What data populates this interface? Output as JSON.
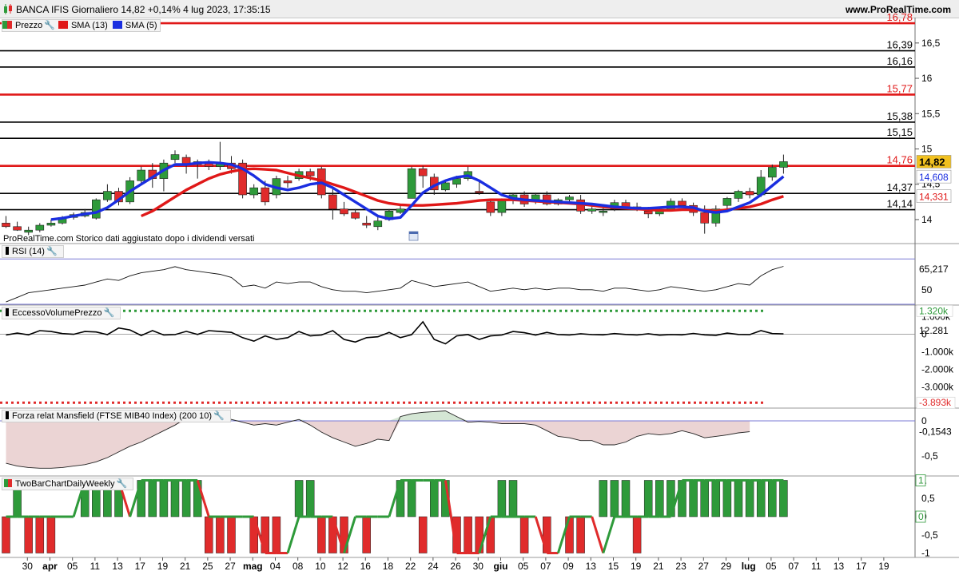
{
  "header": {
    "title": "BANCA IFIS Giornaliero 14,82 +0,14% 4 lug 2023, 17:35:15",
    "site": "www.ProRealTime.com",
    "footnote": "ProRealTime.com  Storico dati aggiustato dopo i dividendi versati"
  },
  "colors": {
    "up": "#2e9a3a",
    "down": "#e02b2b",
    "sma13": "#e01818",
    "sma5": "#1a2ee0",
    "panel_line": "#7a7ad6"
  },
  "price_panel": {
    "legend": [
      {
        "label": "Prezzo",
        "icon": "candle-icon",
        "color": "#2e9a3a"
      },
      {
        "label": "SMA (13)",
        "icon": "square-icon",
        "color": "#e01818"
      },
      {
        "label": "SMA (5)",
        "icon": "square-icon",
        "color": "#1a2ee0"
      }
    ],
    "ylim": [
      13.66,
      16.86
    ],
    "ticks": [
      {
        "v": 16.5,
        "label": "16,5"
      },
      {
        "v": 16,
        "label": "16"
      },
      {
        "v": 15.5,
        "label": "15,5"
      },
      {
        "v": 15,
        "label": "15"
      },
      {
        "v": 14.5,
        "label": "14,5"
      },
      {
        "v": 14,
        "label": "14"
      }
    ],
    "levels": [
      {
        "v": 16.78,
        "label": "16,78",
        "color": "#e01818"
      },
      {
        "v": 16.39,
        "label": "16,39",
        "color": "#000000"
      },
      {
        "v": 16.16,
        "label": "16,16",
        "color": "#000000"
      },
      {
        "v": 15.77,
        "label": "15,77",
        "color": "#e01818"
      },
      {
        "v": 15.38,
        "label": "15,38",
        "color": "#000000"
      },
      {
        "v": 15.15,
        "label": "15,15",
        "color": "#000000"
      },
      {
        "v": 14.76,
        "label": "14,76",
        "color": "#e01818"
      },
      {
        "v": 14.37,
        "label": "14,37",
        "color": "#000000"
      },
      {
        "v": 14.14,
        "label": "14,14",
        "color": "#000000"
      }
    ],
    "last_labels": [
      {
        "v": 14.82,
        "label": "14,82",
        "bg": "#f0c020",
        "fg": "#000000"
      },
      {
        "v": 14.608,
        "label": "14,608",
        "bg": "#ffffff",
        "fg": "#1a2ee0"
      },
      {
        "v": 14.331,
        "label": "14,331",
        "bg": "#ffffff",
        "fg": "#e01818"
      }
    ]
  },
  "x_axis": {
    "ticks": [
      {
        "i": 0,
        "label": "30",
        "bold": false
      },
      {
        "i": 2,
        "label": "apr",
        "bold": true
      },
      {
        "i": 4,
        "label": "05",
        "bold": false
      },
      {
        "i": 6,
        "label": "11",
        "bold": false
      },
      {
        "i": 8,
        "label": "13",
        "bold": false
      },
      {
        "i": 10,
        "label": "17",
        "bold": false
      },
      {
        "i": 12,
        "label": "19",
        "bold": false
      },
      {
        "i": 14,
        "label": "21",
        "bold": false
      },
      {
        "i": 16,
        "label": "25",
        "bold": false
      },
      {
        "i": 18,
        "label": "27",
        "bold": false
      },
      {
        "i": 20,
        "label": "mag",
        "bold": true
      },
      {
        "i": 22,
        "label": "04",
        "bold": false
      },
      {
        "i": 24,
        "label": "08",
        "bold": false
      },
      {
        "i": 26,
        "label": "10",
        "bold": false
      },
      {
        "i": 28,
        "label": "12",
        "bold": false
      },
      {
        "i": 30,
        "label": "16",
        "bold": false
      },
      {
        "i": 32,
        "label": "18",
        "bold": false
      },
      {
        "i": 34,
        "label": "22",
        "bold": false
      },
      {
        "i": 36,
        "label": "24",
        "bold": false
      },
      {
        "i": 38,
        "label": "26",
        "bold": false
      },
      {
        "i": 40,
        "label": "30",
        "bold": false
      },
      {
        "i": 42,
        "label": "giu",
        "bold": true
      },
      {
        "i": 44,
        "label": "05",
        "bold": false
      },
      {
        "i": 46,
        "label": "07",
        "bold": false
      },
      {
        "i": 48,
        "label": "09",
        "bold": false
      },
      {
        "i": 50,
        "label": "13",
        "bold": false
      },
      {
        "i": 52,
        "label": "15",
        "bold": false
      },
      {
        "i": 54,
        "label": "19",
        "bold": false
      },
      {
        "i": 56,
        "label": "21",
        "bold": false
      },
      {
        "i": 58,
        "label": "23",
        "bold": false
      },
      {
        "i": 60,
        "label": "27",
        "bold": false
      },
      {
        "i": 62,
        "label": "29",
        "bold": false
      },
      {
        "i": 64,
        "label": "lug",
        "bold": true
      },
      {
        "i": 66,
        "label": "05",
        "bold": false
      },
      {
        "i": 68,
        "label": "07",
        "bold": false
      },
      {
        "i": 70,
        "label": "11",
        "bold": false
      },
      {
        "i": 72,
        "label": "13",
        "bold": false
      },
      {
        "i": 74,
        "label": "17",
        "bold": false
      },
      {
        "i": 76,
        "label": "19",
        "bold": false
      }
    ]
  },
  "rsi_panel": {
    "legend": "RSI (14)",
    "ylim": [
      40,
      80
    ],
    "ticks": [
      {
        "v": 50,
        "label": "50"
      }
    ],
    "bands": [
      70,
      30
    ],
    "last_label": "65,217"
  },
  "evp_panel": {
    "legend": "EccessoVolumePrezzo",
    "ylim": [
      -4200,
      1650
    ],
    "ticks": [
      {
        "v": 1000,
        "label": "1.000k"
      },
      {
        "v": 0,
        "label": "0"
      },
      {
        "v": -1000,
        "label": "-1.000k"
      },
      {
        "v": -2000,
        "label": "-2.000k"
      },
      {
        "v": -3000,
        "label": "-3.000k"
      }
    ],
    "upper": {
      "v": 1320,
      "label": "1.320k",
      "color": "#2e9a3a"
    },
    "lower": {
      "v": -3893,
      "label": "-3.893k",
      "color": "#e02b2b"
    },
    "last_label": "12.281"
  },
  "mansfield_panel": {
    "legend": "Forza relat Mansfield (FTSE MIB40 Index) (200 10)",
    "ylim": [
      -0.78,
      0.18
    ],
    "ticks": [
      {
        "v": 0,
        "label": "0"
      },
      {
        "v": -0.5,
        "label": "-0,5"
      }
    ],
    "last_label": "-0,1543"
  },
  "twobar_panel": {
    "legend": "TwoBarChartDailyWeekly",
    "ylim": [
      -1.12,
      1.12
    ],
    "ticks": [
      {
        "v": 1,
        "label": "1"
      },
      {
        "v": 0.5,
        "label": "0,5"
      },
      {
        "v": 0,
        "label": "0"
      },
      {
        "v": -0.5,
        "label": "-0,5"
      },
      {
        "v": -1,
        "label": "-1"
      }
    ]
  },
  "chart_data": {
    "type": "candlestick",
    "title": "BANCA IFIS Giornaliero",
    "ohlc": [
      [
        13.95,
        14.05,
        13.88,
        13.9
      ],
      [
        13.9,
        13.97,
        13.84,
        13.85
      ],
      [
        13.82,
        13.9,
        13.78,
        13.85
      ],
      [
        13.85,
        13.95,
        13.82,
        13.92
      ],
      [
        13.92,
        14.0,
        13.9,
        13.95
      ],
      [
        13.95,
        14.05,
        13.93,
        14.03
      ],
      [
        14.03,
        14.1,
        14.0,
        14.07
      ],
      [
        14.05,
        14.15,
        14.03,
        14.1
      ],
      [
        14.02,
        14.3,
        14.0,
        14.28
      ],
      [
        14.28,
        14.5,
        14.25,
        14.4
      ],
      [
        14.4,
        14.45,
        14.2,
        14.25
      ],
      [
        14.25,
        14.6,
        14.22,
        14.55
      ],
      [
        14.55,
        14.75,
        14.5,
        14.7
      ],
      [
        14.7,
        14.8,
        14.45,
        14.58
      ],
      [
        14.58,
        14.85,
        14.4,
        14.8
      ],
      [
        14.85,
        14.98,
        14.8,
        14.92
      ],
      [
        14.88,
        14.92,
        14.65,
        14.78
      ],
      [
        14.78,
        14.85,
        14.58,
        14.82
      ],
      [
        14.82,
        14.85,
        14.7,
        14.75
      ],
      [
        14.75,
        15.1,
        14.7,
        14.8
      ],
      [
        14.8,
        14.9,
        14.65,
        14.72
      ],
      [
        14.8,
        14.85,
        14.3,
        14.35
      ],
      [
        14.35,
        14.5,
        14.3,
        14.45
      ],
      [
        14.45,
        14.55,
        14.2,
        14.25
      ],
      [
        14.35,
        14.62,
        14.3,
        14.58
      ],
      [
        14.55,
        14.62,
        14.45,
        14.52
      ],
      [
        14.58,
        14.72,
        14.55,
        14.68
      ],
      [
        14.68,
        14.72,
        14.55,
        14.62
      ],
      [
        14.72,
        14.75,
        14.3,
        14.35
      ],
      [
        14.35,
        14.45,
        14.0,
        14.15
      ],
      [
        14.15,
        14.25,
        14.05,
        14.08
      ],
      [
        14.1,
        14.15,
        14.0,
        14.02
      ],
      [
        13.95,
        14.05,
        13.88,
        13.92
      ],
      [
        13.9,
        14.05,
        13.85,
        13.98
      ],
      [
        14.0,
        14.15,
        13.98,
        14.12
      ],
      [
        14.1,
        14.2,
        14.08,
        14.15
      ],
      [
        14.3,
        14.75,
        14.3,
        14.72
      ],
      [
        14.72,
        14.76,
        14.45,
        14.62
      ],
      [
        14.6,
        14.65,
        14.35,
        14.42
      ],
      [
        14.42,
        14.55,
        14.4,
        14.52
      ],
      [
        14.5,
        14.62,
        14.45,
        14.58
      ],
      [
        14.58,
        14.75,
        14.55,
        14.68
      ],
      [
        14.4,
        14.55,
        14.35,
        14.38
      ],
      [
        14.25,
        14.28,
        14.05,
        14.1
      ],
      [
        14.1,
        14.3,
        14.05,
        14.28
      ],
      [
        14.3,
        14.38,
        14.22,
        14.35
      ],
      [
        14.35,
        14.4,
        14.18,
        14.22
      ],
      [
        14.28,
        14.38,
        14.22,
        14.35
      ],
      [
        14.35,
        14.4,
        14.2,
        14.22
      ],
      [
        14.22,
        14.3,
        14.2,
        14.28
      ],
      [
        14.28,
        14.35,
        14.25,
        14.32
      ],
      [
        14.28,
        14.35,
        14.08,
        14.12
      ],
      [
        14.12,
        14.22,
        14.08,
        14.15
      ],
      [
        14.1,
        14.2,
        14.05,
        14.12
      ],
      [
        14.15,
        14.28,
        14.12,
        14.24
      ],
      [
        14.24,
        14.28,
        14.16,
        14.18
      ],
      [
        14.18,
        14.24,
        14.12,
        14.14
      ],
      [
        14.12,
        14.18,
        14.02,
        14.08
      ],
      [
        14.08,
        14.16,
        14.05,
        14.14
      ],
      [
        14.14,
        14.3,
        14.12,
        14.26
      ],
      [
        14.26,
        14.3,
        14.18,
        14.2
      ],
      [
        14.2,
        14.24,
        14.05,
        14.1
      ],
      [
        14.1,
        14.2,
        13.8,
        13.95
      ],
      [
        13.95,
        14.2,
        13.9,
        14.15
      ],
      [
        14.2,
        14.32,
        14.15,
        14.3
      ],
      [
        14.3,
        14.42,
        14.25,
        14.4
      ],
      [
        14.4,
        14.45,
        14.3,
        14.35
      ],
      [
        14.35,
        14.7,
        14.32,
        14.6
      ],
      [
        14.6,
        14.78,
        14.55,
        14.74
      ],
      [
        14.74,
        14.92,
        14.65,
        14.82
      ]
    ],
    "sma13": [
      null,
      null,
      null,
      null,
      null,
      null,
      null,
      null,
      null,
      null,
      null,
      null,
      14.05,
      14.12,
      14.22,
      14.32,
      14.42,
      14.5,
      14.58,
      14.64,
      14.68,
      14.71,
      14.72,
      14.71,
      14.7,
      14.66,
      14.62,
      14.59,
      14.55,
      14.5,
      14.45,
      14.39,
      14.33,
      14.27,
      14.23,
      14.21,
      14.2,
      14.2,
      14.21,
      14.22,
      14.23,
      14.25,
      14.27,
      14.28,
      14.28,
      14.28,
      14.27,
      14.26,
      14.25,
      14.24,
      14.23,
      14.22,
      14.2,
      14.18,
      14.17,
      14.16,
      14.15,
      14.14,
      14.13,
      14.13,
      14.14,
      14.14,
      14.13,
      14.12,
      14.14,
      14.16,
      14.18,
      14.22,
      14.28,
      14.33
    ],
    "sma5": [
      null,
      null,
      null,
      null,
      14.0,
      14.02,
      14.05,
      14.08,
      14.1,
      14.17,
      14.28,
      14.4,
      14.5,
      14.6,
      14.7,
      14.78,
      14.78,
      14.8,
      14.81,
      14.8,
      14.78,
      14.72,
      14.62,
      14.5,
      14.45,
      14.42,
      14.45,
      14.5,
      14.52,
      14.45,
      14.35,
      14.25,
      14.15,
      14.05,
      14.01,
      14.03,
      14.2,
      14.38,
      14.48,
      14.55,
      14.6,
      14.62,
      14.55,
      14.45,
      14.35,
      14.3,
      14.28,
      14.27,
      14.26,
      14.25,
      14.24,
      14.23,
      14.22,
      14.2,
      14.18,
      14.17,
      14.16,
      14.16,
      14.17,
      14.18,
      14.18,
      14.17,
      14.12,
      14.1,
      14.12,
      14.18,
      14.24,
      14.35,
      14.48,
      14.61
    ],
    "rsi": [
      42,
      45,
      48,
      49,
      50,
      51,
      52,
      53,
      55,
      57,
      56,
      59,
      61,
      62,
      63,
      65,
      63,
      62,
      61,
      60,
      58,
      52,
      53,
      51,
      55,
      54,
      55,
      55,
      52,
      50,
      49,
      49,
      48,
      49,
      50,
      51,
      56,
      54,
      52,
      53,
      54,
      55,
      52,
      49,
      50,
      51,
      50,
      51,
      50,
      51,
      51,
      50,
      50,
      49,
      51,
      51,
      50,
      49,
      50,
      52,
      51,
      50,
      49,
      50,
      52,
      54,
      53,
      59,
      63,
      65.2
    ],
    "evp": [
      -50,
      60,
      -40,
      200,
      150,
      30,
      -10,
      150,
      120,
      -30,
      350,
      240,
      -80,
      200,
      -50,
      -30,
      160,
      -20,
      200,
      150,
      100,
      -200,
      -400,
      -100,
      -300,
      -200,
      150,
      -100,
      -50,
      200,
      -300,
      -450,
      -200,
      -150,
      100,
      -200,
      -30,
      700,
      -300,
      -550,
      -100,
      -30,
      -300,
      -100,
      -50,
      150,
      80,
      -50,
      100,
      -30,
      -50,
      20,
      -30,
      -40,
      30,
      -20,
      -50,
      20,
      -60,
      -30,
      -40,
      40,
      -40,
      -70,
      60,
      -20,
      -30,
      200,
      30,
      12.281
    ],
    "mansfield": [
      -0.6,
      -0.64,
      -0.66,
      -0.67,
      -0.67,
      -0.66,
      -0.64,
      -0.62,
      -0.58,
      -0.52,
      -0.44,
      -0.36,
      -0.3,
      -0.22,
      -0.14,
      -0.06,
      0.04,
      0.12,
      0.1,
      0.08,
      0.02,
      -0.02,
      -0.06,
      -0.04,
      -0.06,
      -0.02,
      0.02,
      -0.06,
      -0.16,
      -0.24,
      -0.3,
      -0.36,
      -0.32,
      -0.26,
      -0.28,
      0.06,
      0.1,
      0.12,
      0.13,
      0.14,
      0.06,
      -0.02,
      -0.01,
      -0.02,
      -0.04,
      -0.04,
      -0.04,
      -0.06,
      -0.14,
      -0.22,
      -0.24,
      -0.28,
      -0.28,
      -0.34,
      -0.34,
      -0.3,
      -0.22,
      -0.18,
      -0.2,
      -0.18,
      -0.14,
      -0.18,
      -0.24,
      -0.22,
      -0.2,
      -0.17,
      -0.1543
    ],
    "twobar_weekly": [
      0,
      0,
      0,
      0,
      0,
      0,
      0,
      1,
      1,
      1,
      1,
      0,
      1,
      1,
      1,
      1,
      1,
      1,
      0,
      0,
      0,
      0,
      0,
      -1,
      -1,
      -1,
      0,
      0,
      0,
      0,
      -1,
      0,
      0,
      0,
      0,
      1,
      1,
      1,
      1,
      1,
      -1,
      -1,
      -1,
      0,
      0,
      0,
      0,
      0,
      -1,
      -1,
      0,
      0,
      0,
      -1,
      0,
      0,
      0,
      0,
      0,
      0,
      1,
      1,
      1,
      1,
      1,
      1,
      1,
      1,
      1,
      1
    ],
    "twobar_bars": [
      -1,
      1,
      -1,
      -1,
      -1,
      0,
      0,
      1,
      1,
      1,
      1,
      0,
      1,
      1,
      1,
      1,
      1,
      1,
      -1,
      -1,
      -1,
      0,
      -1,
      -1,
      -1,
      0,
      1,
      1,
      -1,
      -1,
      -1,
      0,
      -1,
      0,
      0,
      1,
      1,
      -1,
      1,
      1,
      -1,
      -1,
      -1,
      -1,
      1,
      1,
      -1,
      0,
      -1,
      0,
      -1,
      -1,
      0,
      1,
      1,
      1,
      -1,
      1,
      1,
      1,
      1,
      1,
      1,
      1,
      1,
      1,
      1,
      1,
      1,
      1
    ]
  }
}
